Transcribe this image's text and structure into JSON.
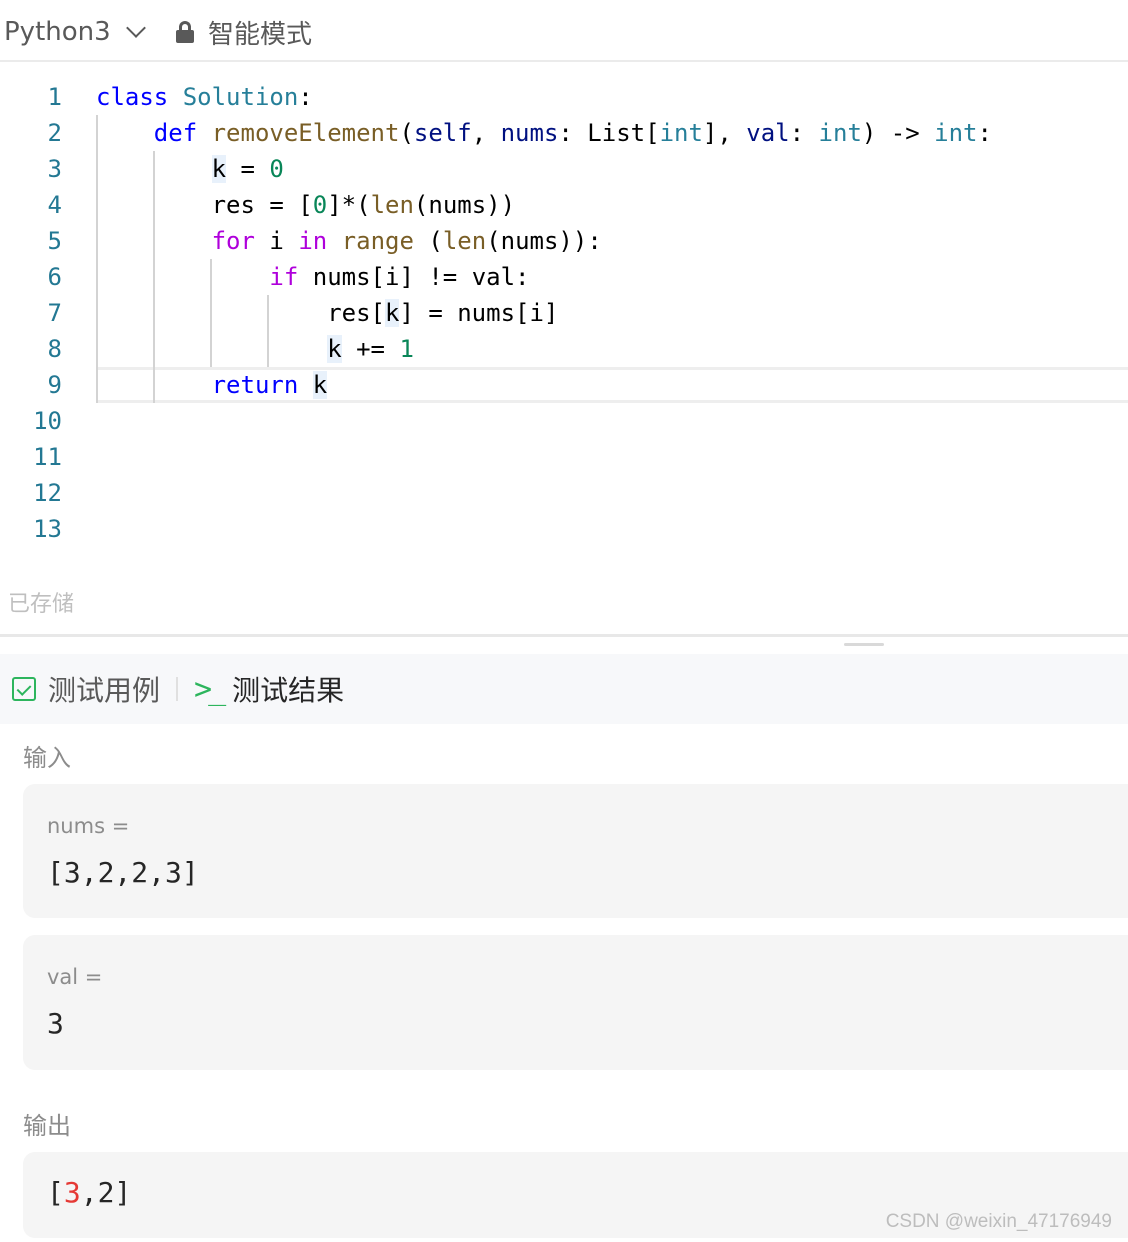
{
  "toolbar": {
    "language": "Python3",
    "mode": "智能模式",
    "icons": {
      "language_dropdown": "chevron-down-icon",
      "mode": "lock-icon"
    }
  },
  "editor": {
    "line_numbers": [
      "1",
      "2",
      "3",
      "4",
      "5",
      "6",
      "7",
      "8",
      "9",
      "10",
      "11",
      "12",
      "13"
    ],
    "code_lines": [
      "class Solution:",
      "    def removeElement(self, nums: List[int], val: int) -> int:",
      "        k = 0",
      "        res = [0]*(len(nums))",
      "        for i in range (len(nums)):",
      "            if nums[i] != val:",
      "                res[k] = nums[i]",
      "                k += 1",
      "        return k",
      "",
      "",
      "",
      ""
    ],
    "cursor_line": 9,
    "status": "已存储"
  },
  "panel": {
    "tabs": [
      {
        "label": "测试用例",
        "icon": "checkbox-icon"
      },
      {
        "label": "测试结果",
        "icon": "terminal-icon",
        "active": true
      }
    ],
    "input_label": "输入",
    "inputs": [
      {
        "name": "nums =",
        "value": "[3,2,2,3]"
      },
      {
        "name": "val =",
        "value": "3"
      }
    ],
    "output_label": "输出",
    "output": {
      "open": "[",
      "first": "3",
      "rest": ",2]"
    }
  },
  "watermark": "CSDN @weixin_47176949",
  "colors": {
    "keyword": "#0000ff",
    "control_keyword": "#af00db",
    "class_name": "#267f99",
    "function": "#795e26",
    "parameter": "#001080",
    "number": "#098658",
    "line_number": "#237893",
    "accent_green": "#2db55d",
    "diff_red": "#e53935"
  }
}
